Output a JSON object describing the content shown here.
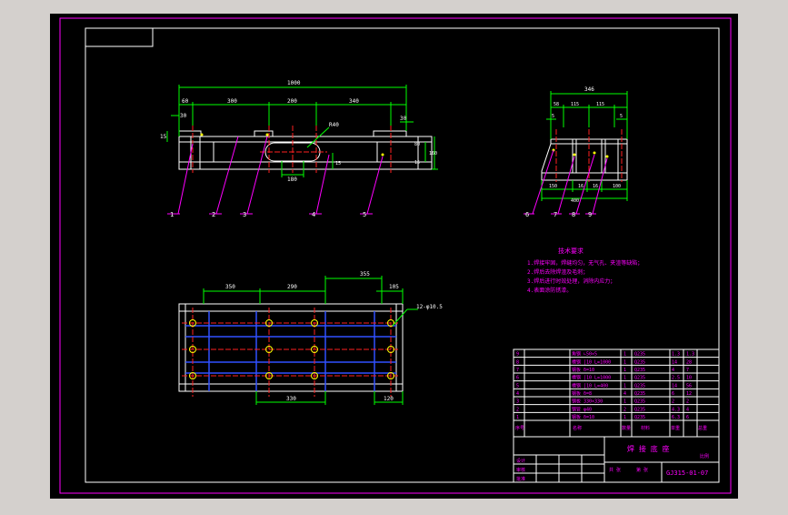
{
  "viewer": {
    "background_color": "#d4d0cd",
    "sheet_color": "#000000",
    "frame_color": "#ff00ff",
    "border_color": "#ffffff"
  },
  "front_view": {
    "overall": "1000",
    "dims": [
      "60",
      "300",
      "200",
      "340"
    ],
    "left_small": "30",
    "right_small": "30",
    "side_small": "15",
    "radius": "R40",
    "slot_width": "180",
    "right_dims": [
      "80",
      "160",
      "15"
    ],
    "inner_dim": "15",
    "callouts": [
      "1",
      "2",
      "3",
      "4",
      "5"
    ]
  },
  "side_view": {
    "overall": "346",
    "dims": [
      "58",
      "115",
      "115",
      "5"
    ],
    "left_small": "5",
    "bottom_dims": [
      "150",
      "16",
      "16",
      "100",
      "400"
    ],
    "callouts": [
      "6",
      "7",
      "8",
      "9"
    ]
  },
  "top_view": {
    "dims": [
      "350",
      "290",
      "355",
      "105"
    ],
    "hole_note": "12-φ10.5",
    "bottom_dims": [
      "330",
      "120"
    ]
  },
  "notes": {
    "title": "技术要求",
    "items": [
      "1.焊接牢固，焊缝均匀，无气孔、夹渣等缺陷；",
      "2.焊后去除焊渣及毛刺；",
      "3.焊后进行时效处理，消除内应力；",
      "4.表面涂防锈漆。"
    ]
  },
  "title_block": {
    "rows": [
      {
        "no": "9",
        "name": "角钢 ∟50×5",
        "qty": "1",
        "mat": "Q235",
        "w1": "1.3",
        "w2": "1.3"
      },
      {
        "no": "8",
        "name": "槽钢 [10 L=1000",
        "qty": "1",
        "mat": "Q235",
        "w1": "14",
        "w2": "28"
      },
      {
        "no": "7",
        "name": "钢板 δ=10",
        "qty": "1",
        "mat": "Q235",
        "w1": "4",
        "w2": "7"
      },
      {
        "no": "6",
        "name": "槽钢 [10 L=1000",
        "qty": "1",
        "mat": "Q235",
        "w1": "2.5",
        "w2": "10"
      },
      {
        "no": "5",
        "name": "槽钢 [10 L=400",
        "qty": "1",
        "mat": "Q235",
        "w1": "14",
        "w2": "56"
      },
      {
        "no": "4",
        "name": "钢板 δ=8",
        "qty": "4",
        "mat": "Q235",
        "w1": "6",
        "w2": "12"
      },
      {
        "no": "3",
        "name": "钢板 330×330",
        "qty": "1",
        "mat": "Q235",
        "w1": "2",
        "w2": "2"
      },
      {
        "no": "2",
        "name": "钢管 φ40",
        "qty": "2",
        "mat": "Q235",
        "w1": "4.3",
        "w2": "4"
      },
      {
        "no": "1",
        "name": "钢板 δ=10",
        "qty": "1",
        "mat": "Q235",
        "w1": "6.3",
        "w2": "6"
      }
    ],
    "header": [
      "序号",
      "名称",
      "数量",
      "材料",
      "单重",
      "总重"
    ],
    "drawing_title": "焊 接 底 座",
    "scale_label": "比例",
    "drawing_no": "GJ315-01-07",
    "sign_labels": [
      "设计",
      "审核",
      "批准"
    ],
    "sheet_labels": [
      "共 张",
      "第 张"
    ]
  }
}
